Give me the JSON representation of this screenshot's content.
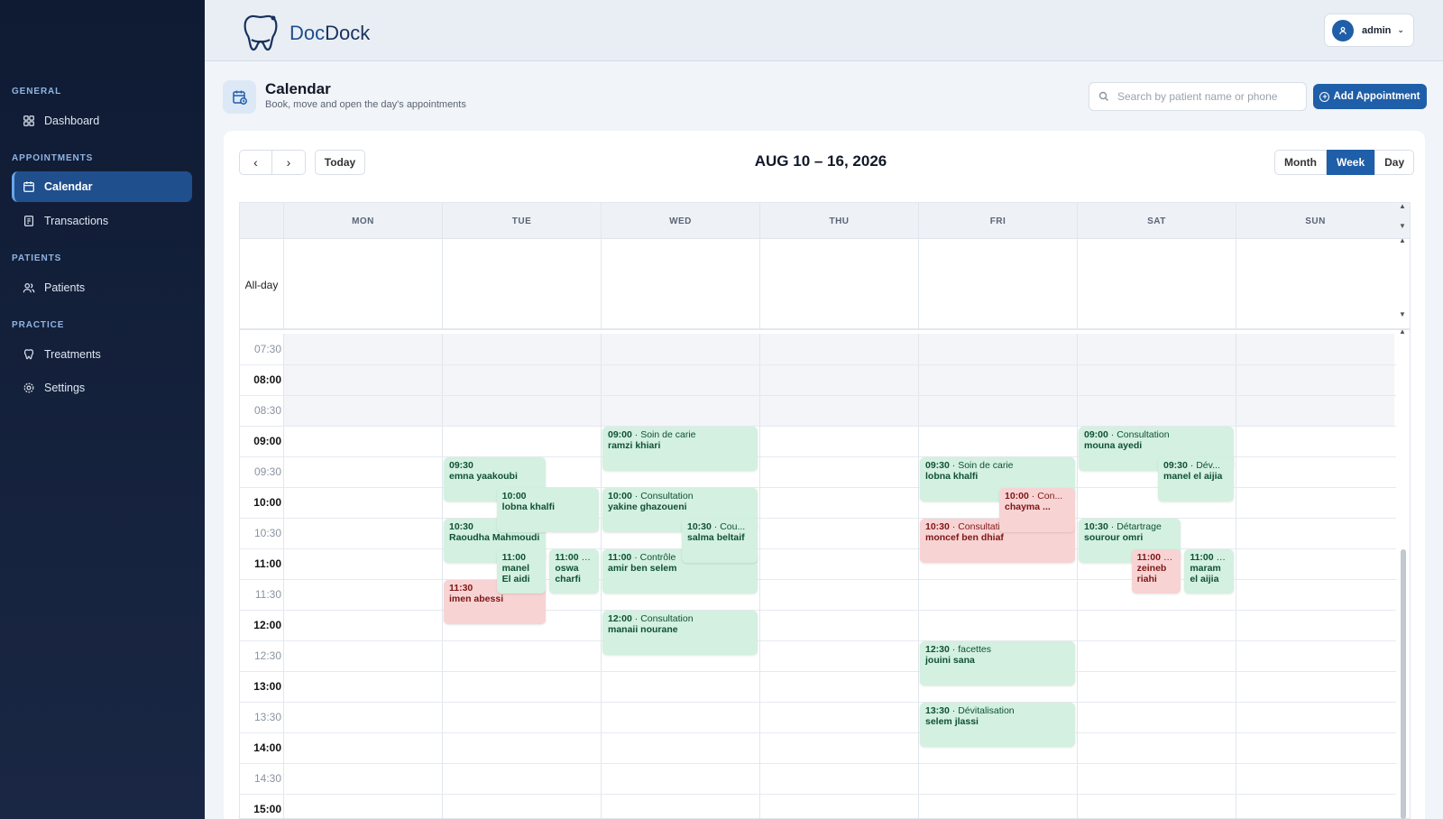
{
  "app": {
    "logo_part1": "Doc",
    "logo_part2": "Dock"
  },
  "user": {
    "name": "admin"
  },
  "sidebar": {
    "sections": [
      {
        "label": "GENERAL",
        "items": [
          {
            "label": "Dashboard",
            "icon": "dashboard-icon"
          }
        ]
      },
      {
        "label": "APPOINTMENTS",
        "items": [
          {
            "label": "Calendar",
            "icon": "calendar-icon",
            "active": true
          },
          {
            "label": "Transactions",
            "icon": "receipt-icon"
          }
        ]
      },
      {
        "label": "PATIENTS",
        "items": [
          {
            "label": "Patients",
            "icon": "users-icon"
          }
        ]
      },
      {
        "label": "PRACTICE",
        "items": [
          {
            "label": "Treatments",
            "icon": "tooth-icon"
          },
          {
            "label": "Settings",
            "icon": "gear-icon"
          }
        ]
      }
    ]
  },
  "page": {
    "title": "Calendar",
    "subtitle": "Book, move and open the day's appointments",
    "search_placeholder": "Search by patient name or phone",
    "add_button": "Add Appointment"
  },
  "toolbar": {
    "today": "Today",
    "range": "AUG 10 – 16, 2026",
    "views": [
      "Month",
      "Week",
      "Day"
    ],
    "active_view": "Week"
  },
  "calendar": {
    "days": [
      "MON",
      "TUE",
      "WED",
      "THU",
      "FRI",
      "SAT",
      "SUN"
    ],
    "allday_label": "All-day",
    "times": [
      "07:30",
      "08:00",
      "08:30",
      "09:00",
      "09:30",
      "10:00",
      "10:30",
      "11:00",
      "11:30",
      "12:00",
      "12:30",
      "13:00",
      "13:30",
      "14:00",
      "14:30",
      "15:00"
    ],
    "events": [
      {
        "day": 2,
        "start": "09:00",
        "end": "09:45",
        "col": 0,
        "cols": 1,
        "color": "green",
        "time": "09:00",
        "type": "Soin de carie",
        "name": "ramzi khiari"
      },
      {
        "day": 1,
        "start": "09:30",
        "end": "10:15",
        "col": 0,
        "cols": 3,
        "span": 2,
        "color": "green",
        "time": "09:30",
        "type": "",
        "name": "emna yaakoubi"
      },
      {
        "day": 1,
        "start": "10:00",
        "end": "10:45",
        "col": 1,
        "cols": 3,
        "span": 2,
        "color": "green",
        "time": "10:00",
        "type": "",
        "name": "lobna khalfi"
      },
      {
        "day": 1,
        "start": "10:30",
        "end": "11:15",
        "col": 0,
        "cols": 3,
        "span": 2,
        "color": "green",
        "time": "10:30",
        "type": "",
        "name": "Raoudha Mahmoudi"
      },
      {
        "day": 1,
        "start": "11:00",
        "end": "11:45",
        "col": 1,
        "cols": 3,
        "span": 1,
        "color": "green",
        "time": "11:00",
        "type": "",
        "name": "manel El aidi"
      },
      {
        "day": 1,
        "start": "11:00",
        "end": "11:45",
        "col": 2,
        "cols": 3,
        "span": 1,
        "color": "green",
        "time": "11:00",
        "type": "...",
        "name": "oswa charfi"
      },
      {
        "day": 1,
        "start": "11:30",
        "end": "12:15",
        "col": 0,
        "cols": 3,
        "span": 2,
        "color": "red",
        "time": "11:30",
        "type": "",
        "name": "imen abessi"
      },
      {
        "day": 2,
        "start": "10:00",
        "end": "10:45",
        "col": 0,
        "cols": 1,
        "color": "green",
        "time": "10:00",
        "type": "Consultation",
        "name": "yakine ghazoueni"
      },
      {
        "day": 2,
        "start": "10:30",
        "end": "11:15",
        "col": 1,
        "cols": 2,
        "span": 1,
        "color": "green",
        "time": "10:30",
        "type": "Cou...",
        "name": "salma beltaif"
      },
      {
        "day": 2,
        "start": "11:00",
        "end": "11:45",
        "col": 0,
        "cols": 1,
        "color": "green",
        "time": "11:00",
        "type": "Contrôle",
        "name": "amir ben selem"
      },
      {
        "day": 2,
        "start": "12:00",
        "end": "12:45",
        "col": 0,
        "cols": 1,
        "color": "green",
        "time": "12:00",
        "type": "Consultation",
        "name": "manaii nourane"
      },
      {
        "day": 4,
        "start": "09:30",
        "end": "10:15",
        "col": 0,
        "cols": 1,
        "color": "green",
        "time": "09:30",
        "type": "Soin de carie",
        "name": "lobna khalfi"
      },
      {
        "day": 4,
        "start": "10:00",
        "end": "10:45",
        "col": 1,
        "cols": 2,
        "span": 1,
        "color": "red",
        "time": "10:00",
        "type": "Con...",
        "name": "chayma ..."
      },
      {
        "day": 4,
        "start": "10:30",
        "end": "11:15",
        "col": 0,
        "cols": 1,
        "color": "red",
        "time": "10:30",
        "type": "Consultation",
        "name": "moncef ben dhiaf"
      },
      {
        "day": 4,
        "start": "12:30",
        "end": "13:15",
        "col": 0,
        "cols": 1,
        "color": "green",
        "time": "12:30",
        "type": "facettes",
        "name": "jouini sana"
      },
      {
        "day": 4,
        "start": "13:30",
        "end": "14:15",
        "col": 0,
        "cols": 1,
        "color": "green",
        "time": "13:30",
        "type": "Dévitalisation",
        "name": "selem jlassi"
      },
      {
        "day": 5,
        "start": "09:00",
        "end": "09:45",
        "col": 0,
        "cols": 1,
        "color": "green",
        "time": "09:00",
        "type": "Consultation",
        "name": "mouna ayedi"
      },
      {
        "day": 5,
        "start": "09:30",
        "end": "10:15",
        "col": 1,
        "cols": 2,
        "span": 1,
        "color": "green",
        "time": "09:30",
        "type": "Dév...",
        "name": "manel el aijia"
      },
      {
        "day": 5,
        "start": "10:30",
        "end": "11:15",
        "col": 0,
        "cols": 3,
        "span": 2,
        "color": "green",
        "time": "10:30",
        "type": "Détartrage",
        "name": "sourour omri"
      },
      {
        "day": 5,
        "start": "11:00",
        "end": "11:45",
        "col": 1,
        "cols": 3,
        "span": 1,
        "color": "red",
        "time": "11:00",
        "type": "Co...",
        "name": "zeineb riahi"
      },
      {
        "day": 5,
        "start": "11:00",
        "end": "11:45",
        "col": 2,
        "cols": 3,
        "span": 1,
        "color": "green",
        "time": "11:00",
        "type": "...",
        "name": "maram el aijia"
      }
    ]
  },
  "colors": {
    "primary": "#1f5ea8",
    "sidebar": "#0f1b33",
    "event_green": "#d3f0e0",
    "event_red": "#f8d3d3"
  }
}
